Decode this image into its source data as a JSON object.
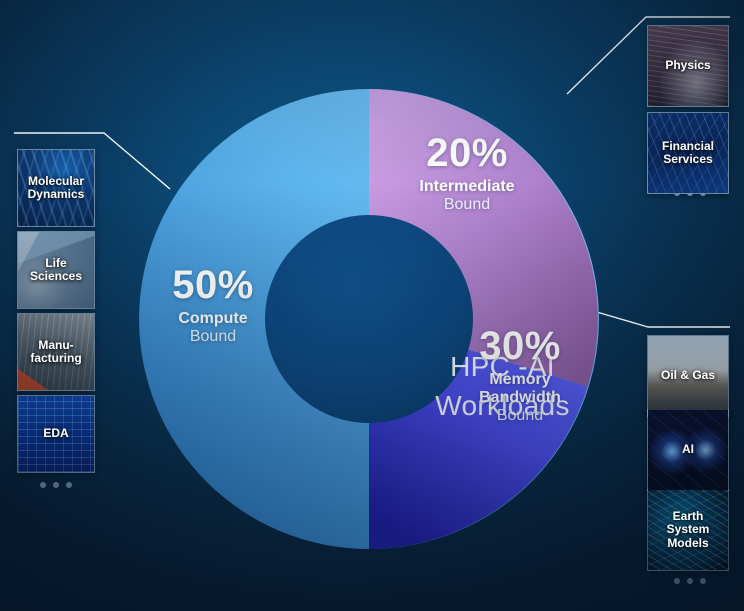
{
  "chart_data": {
    "type": "pie",
    "title": "HPC -AI Workloads",
    "subtitle": "",
    "xlabel": "",
    "ylabel": "",
    "legend_position": "on-slice",
    "center_label_line1": "HPC -AI",
    "center_label_line2": "Workloads",
    "categories": [
      "Compute Bound",
      "Intermediate Bound",
      "Memory Bandwidth Bound"
    ],
    "values": [
      50,
      20,
      30
    ],
    "value_labels": [
      "50%",
      "20%",
      "30%"
    ],
    "slices": [
      {
        "name": "Compute Bound",
        "percent": 50,
        "percent_label": "50%",
        "label_line1": "Compute",
        "label_line2": "Bound",
        "color_start": "#6ec1f5",
        "color_end": "#2f7dc2"
      },
      {
        "name": "Intermediate Bound",
        "percent": 20,
        "percent_label": "20%",
        "label_line1": "Intermediate",
        "label_line2": "Bound",
        "color_start": "#c79adf",
        "color_end": "#8a5ba0"
      },
      {
        "name": "Memory Bandwidth Bound",
        "percent": 30,
        "percent_label": "30%",
        "label_line1": "Memory",
        "label_line1b": "Bandwidth",
        "label_line2": "Bound",
        "color_start": "#5a63f0",
        "color_end": "#1f1fa6"
      }
    ]
  },
  "background": {
    "color_top": "#0f5a89",
    "color_bottom": "#07203a"
  },
  "donut": {
    "inner_circle_color": "#0d477e"
  },
  "left_panel": {
    "group_label": "",
    "cards": [
      {
        "caption_line1": "Molecular",
        "caption_line2": "Dynamics",
        "art": "art-dna",
        "name": "molecular-dynamics"
      },
      {
        "caption_line1": "Life",
        "caption_line2": "Sciences",
        "art": "art-lab",
        "name": "life-sciences"
      },
      {
        "caption_line1": "Manu-",
        "caption_line2": "facturing",
        "art": "art-manu",
        "name": "manufacturing"
      },
      {
        "caption_line1": "EDA",
        "caption_line2": "",
        "art": "art-eda",
        "name": "eda"
      }
    ],
    "more_dots": 3
  },
  "right_top_panel": {
    "cards": [
      {
        "caption_line1": "Physics",
        "caption_line2": "",
        "art": "art-physics",
        "name": "physics"
      },
      {
        "caption_line1": "Financial",
        "caption_line2": "Services",
        "art": "art-finance",
        "name": "financial-services"
      }
    ],
    "more_dots": 3
  },
  "right_bottom_panel": {
    "cards": [
      {
        "caption_line1": "Oil & Gas",
        "caption_line2": "",
        "art": "art-oil",
        "name": "oil-and-gas"
      },
      {
        "caption_line1": "AI",
        "caption_line2": "",
        "art": "art-ai",
        "name": "ai"
      },
      {
        "caption_line1": "Earth",
        "caption_line1b": "System",
        "caption_line2": "Models",
        "art": "art-earth",
        "name": "earth-system-models"
      }
    ],
    "more_dots": 3
  }
}
